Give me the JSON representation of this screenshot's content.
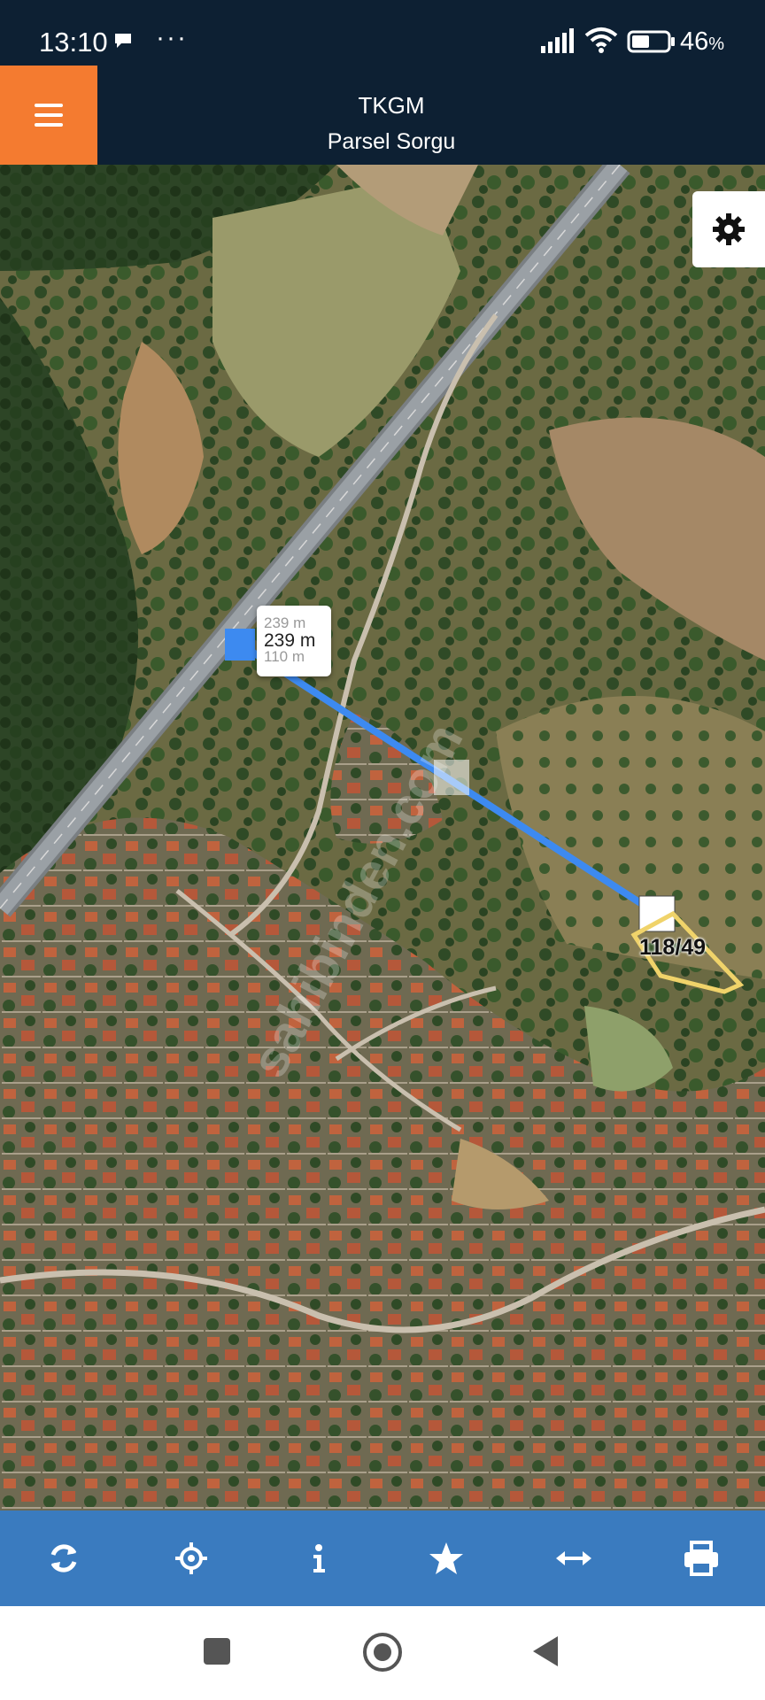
{
  "status_bar": {
    "time": "13:10",
    "more_indicator": "···",
    "battery_percent": "46",
    "battery_suffix": "%",
    "icons": [
      "message-icon",
      "signal-icon",
      "wifi-icon",
      "battery-icon"
    ]
  },
  "header": {
    "title": "TKGM",
    "subtitle": "Parsel Sorgu",
    "menu_icon": "hamburger-menu-icon",
    "accent_color": "#f47b30",
    "background_color": "#0d2033"
  },
  "map": {
    "settings_icon": "gear-icon",
    "measurement": {
      "distance_label": "239 m",
      "ghost_label_top": "239 m",
      "ghost_label_bottom": "110 m",
      "line_color": "#3d8af0"
    },
    "parcel": {
      "label": "118/49",
      "outline_color": "#f0d36a"
    },
    "watermark": "sahibinden.com"
  },
  "toolbar": {
    "background_color": "#3a7bbf",
    "buttons": [
      {
        "icon": "refresh-icon"
      },
      {
        "icon": "locate-crosshair-icon"
      },
      {
        "icon": "info-icon"
      },
      {
        "icon": "star-icon"
      },
      {
        "icon": "measure-arrows-icon"
      },
      {
        "icon": "print-icon"
      }
    ]
  },
  "nav_bar": {
    "icons": [
      "recent-apps-icon",
      "home-icon",
      "back-icon"
    ]
  }
}
